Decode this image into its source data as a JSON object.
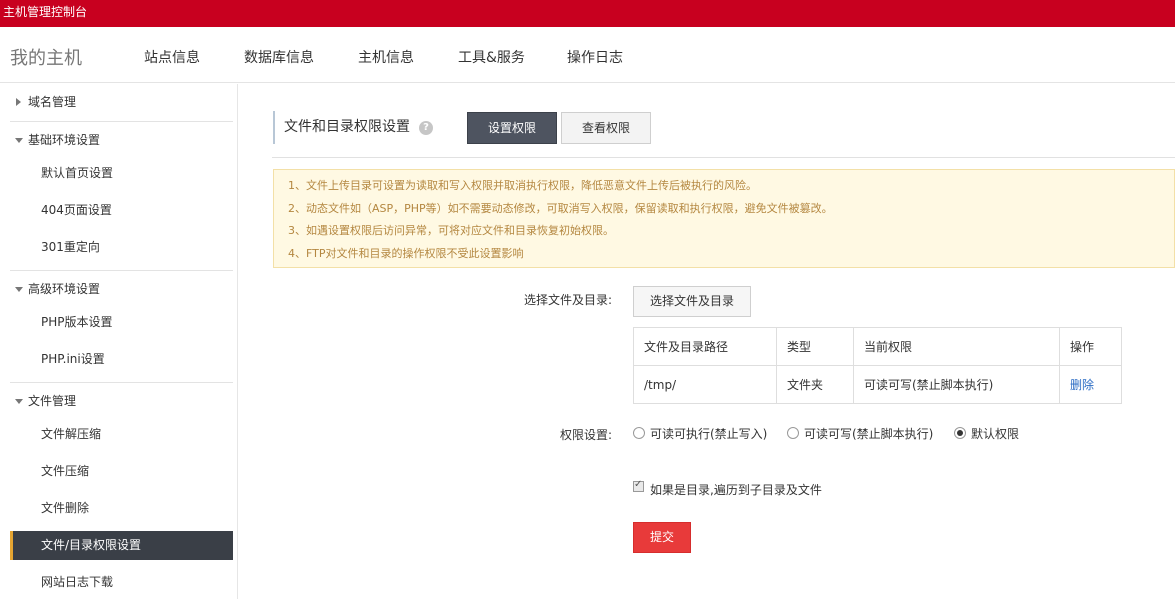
{
  "topbar": {
    "title": "主机管理控制台"
  },
  "nav": {
    "brand": "我的主机",
    "items": [
      "站点信息",
      "数据库信息",
      "主机信息",
      "工具&服务",
      "操作日志"
    ]
  },
  "sidebar": {
    "groups": [
      {
        "label": "域名管理",
        "items": []
      },
      {
        "label": "基础环境设置",
        "items": [
          "默认首页设置",
          "404页面设置",
          "301重定向"
        ]
      },
      {
        "label": "高级环境设置",
        "items": [
          "PHP版本设置",
          "PHP.ini设置"
        ]
      },
      {
        "label": "文件管理",
        "items": [
          "文件解压缩",
          "文件压缩",
          "文件删除",
          "文件/目录权限设置",
          "网站日志下载"
        ]
      }
    ],
    "active": "文件/目录权限设置"
  },
  "main": {
    "title": "文件和目录权限设置",
    "help": "?",
    "tab_set": "设置权限",
    "tab_view": "查看权限",
    "notices": [
      "1、文件上传目录可设置为读取和写入权限并取消执行权限，降低恶意文件上传后被执行的风险。",
      "2、动态文件如（ASP，PHP等）如不需要动态修改，可取消写入权限，保留读取和执行权限，避免文件被篡改。",
      "3、如遇设置权限后访问异常，可将对应文件和目录恢复初始权限。",
      "4、FTP对文件和目录的操作权限不受此设置影响"
    ],
    "select_label": "选择文件及目录:",
    "select_button": "选择文件及目录",
    "table": {
      "headers": [
        "文件及目录路径",
        "类型",
        "当前权限",
        "操作"
      ],
      "rows": [
        {
          "path": "/tmp/",
          "type": "文件夹",
          "perm": "可读可写(禁止脚本执行)",
          "action": "删除"
        }
      ]
    },
    "perm_label": "权限设置:",
    "perm_options": [
      "可读可执行(禁止写入)",
      "可读可写(禁止脚本执行)",
      "默认权限"
    ],
    "perm_selected": "默认权限",
    "recursive_label": "如果是目录,遍历到子目录及文件",
    "recursive_checked": true,
    "submit": "提交"
  },
  "colors": {
    "topbar": "#c8001f",
    "sidebar_active": "#3a3f47",
    "submit": "#e83a3a",
    "notice_bg": "#fff9e3",
    "link": "#2b6cc4"
  }
}
